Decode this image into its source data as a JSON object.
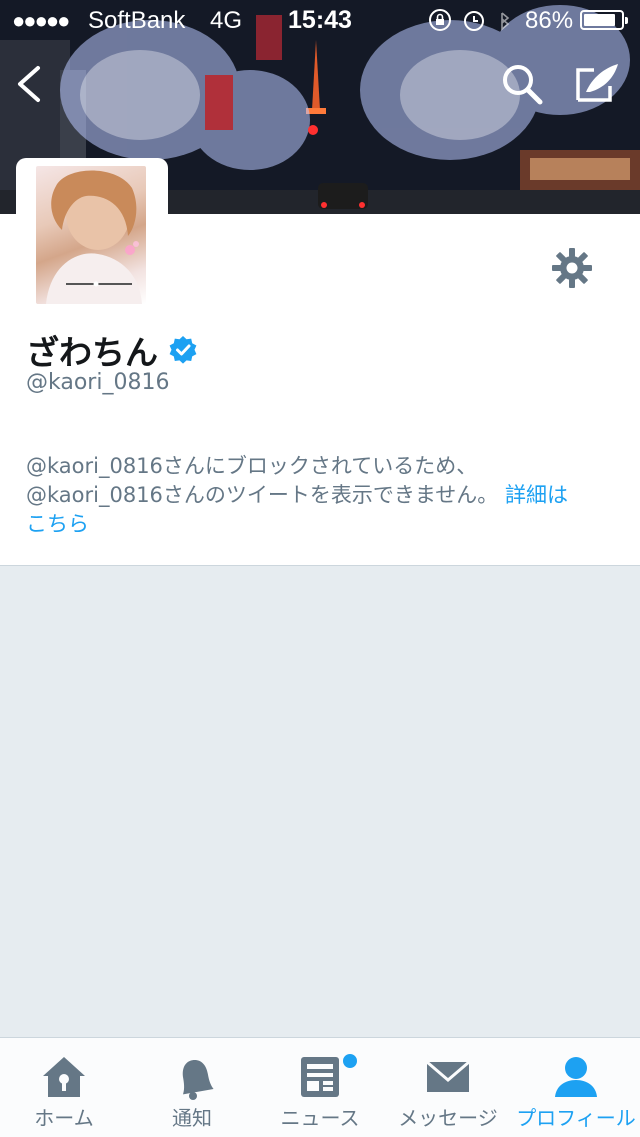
{
  "status_bar": {
    "signal": "●●●●●",
    "carrier": "SoftBank",
    "network": "4G",
    "time": "15:43",
    "battery_percent": "86%",
    "battery_level": 0.86
  },
  "header": {
    "back_icon": "chevron-left-icon",
    "search_icon": "search-icon",
    "compose_icon": "compose-tweet-icon"
  },
  "profile": {
    "display_name": "ざわちん",
    "handle": "@kaori_0816",
    "verified": true,
    "settings_icon": "gear-icon"
  },
  "notice": {
    "line1": "@kaori_0816さんにブロックされているため、",
    "line2_prefix": "@kaori_0816さんのツイートを表示できません。",
    "link_part1": "詳細は",
    "link_part2": "こちら"
  },
  "tab_bar": {
    "tabs": [
      {
        "label": "ホーム",
        "icon": "home-icon",
        "active": false
      },
      {
        "label": "通知",
        "icon": "bell-icon",
        "active": false
      },
      {
        "label": "ニュース",
        "icon": "news-icon",
        "active": false,
        "has_badge": true
      },
      {
        "label": "メッセージ",
        "icon": "envelope-icon",
        "active": false
      },
      {
        "label": "プロフィール",
        "icon": "person-icon",
        "active": true
      }
    ]
  },
  "colors": {
    "accent": "#1da1f2",
    "icon_gray": "#657786",
    "background": "#e6ecf0"
  }
}
